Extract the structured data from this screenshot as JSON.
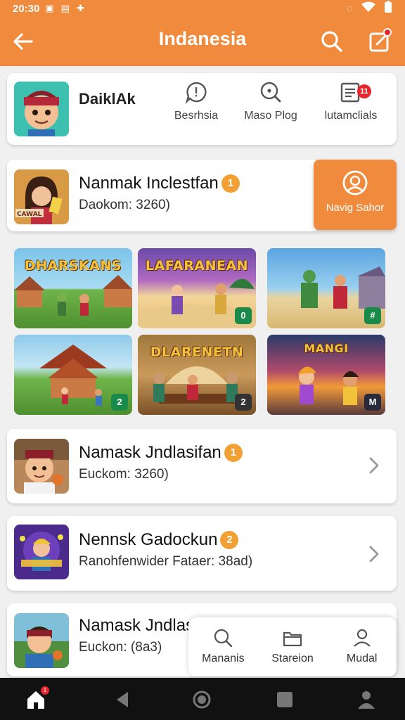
{
  "status_bar": {
    "time": "20:30",
    "icons": [
      "sim-icon",
      "briefcase-icon",
      "gear-icon",
      "vibrate-icon",
      "wifi-icon",
      "battery-icon"
    ]
  },
  "app_bar": {
    "title": "Indanesia",
    "icons": [
      "back-arrow-icon",
      "search-icon",
      "edit-icon"
    ]
  },
  "profile_card": {
    "name": "DaiklAk",
    "actions": [
      {
        "label": "Besrhsia",
        "icon": "chat-icon"
      },
      {
        "label": "Maso Plog",
        "icon": "search-icon"
      },
      {
        "label": "lutamclials",
        "icon": "list-icon",
        "badge": "11"
      }
    ]
  },
  "featured": {
    "title": "Nanmak Inclestfan",
    "rank": "1",
    "subtitle": "Daokom: 3260)",
    "cta_label": "Navig Sahor"
  },
  "tiles": [
    {
      "title": "DHARSKANS",
      "badge": ""
    },
    {
      "title": "LAFARANEAN",
      "badge": "0"
    },
    {
      "title": "",
      "badge": "#"
    },
    {
      "title": "",
      "badge": "2"
    },
    {
      "title": "DLARENETN",
      "badge": "2"
    },
    {
      "title": "MANGI",
      "badge": "M"
    }
  ],
  "list": [
    {
      "title": "Namask Jndlasifan",
      "rank": "1",
      "subtitle": "Euckom: 3260)"
    },
    {
      "title": "Nennsk Gadockun",
      "rank": "2",
      "subtitle": "Ranohfenwider Fataer: 38ad)"
    },
    {
      "title": "Namask Jndlaslí",
      "rank": "",
      "subtitle": "Euckon: (8a3)"
    }
  ],
  "floating_bar": [
    {
      "label": "Mananis",
      "icon": "search-icon"
    },
    {
      "label": "Stareion",
      "icon": "folder-icon"
    },
    {
      "label": "Mudal",
      "icon": "person-icon"
    }
  ],
  "nav_bar": {
    "icons": [
      "home-icon",
      "back-triangle-icon",
      "home-circle-icon",
      "recents-icon",
      "profile-icon"
    ],
    "home_badge": "1"
  },
  "colors": {
    "accent": "#f08a3c",
    "badge": "#f2a033",
    "alert": "#e5262c"
  }
}
